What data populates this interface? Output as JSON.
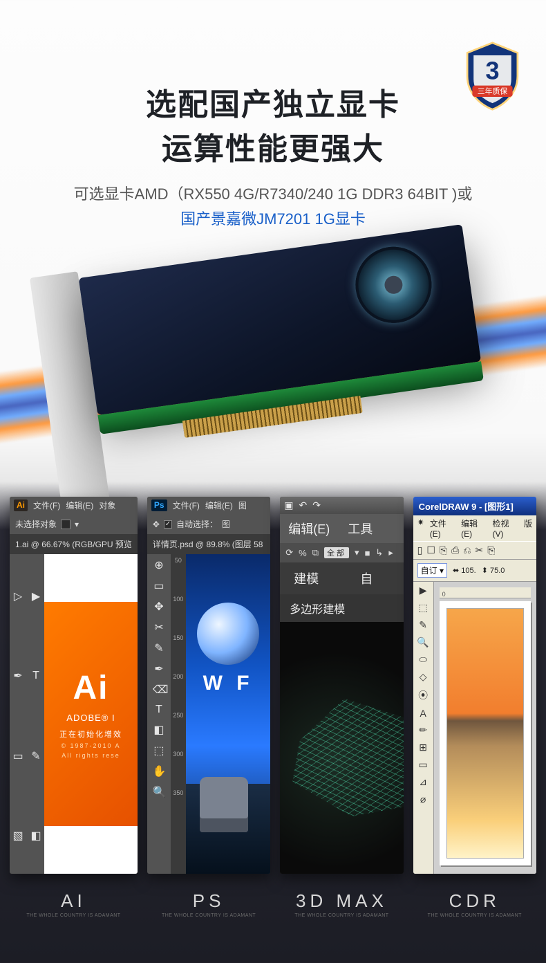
{
  "badge": {
    "year_label": "三年质保",
    "number": "3"
  },
  "hero": {
    "title_line1": "选配国产独立显卡",
    "title_line2": "运算性能更强大",
    "subtitle1": "可选显卡AMD（RX550 4G/R7340/240 1G DDR3 64BIT )或",
    "subtitle2": "国产景嘉微JM7201 1G显卡"
  },
  "apps": {
    "ai": {
      "logo": "Ai",
      "menu": [
        "文件(F)",
        "编辑(E)",
        "对象"
      ],
      "option_row_label": "未选择对象",
      "tab_label": "1.ai @ 66.67% (RGB/GPU 预览",
      "splash_logo": "Ai",
      "splash_name": "ADOBE® I",
      "splash_init": "正在初始化增效",
      "splash_copy1": "© 1987-2010 A",
      "splash_copy2": "All rights rese",
      "label": "AI",
      "sub": "THE WHOLE COUNTRY IS ADAMANT",
      "tools": [
        "▷",
        "▶",
        "✒",
        "T",
        "▭",
        "✎",
        "▧",
        "◧"
      ]
    },
    "ps": {
      "logo": "Ps",
      "menu": [
        "文件(F)",
        "编辑(E)",
        "图"
      ],
      "move_label": "自动选择：",
      "move_value": "图",
      "tab_label": "详情页.psd @ 89.8% (图层 58",
      "ruler": [
        "50",
        "100",
        "150",
        "200",
        "250",
        "300",
        "350"
      ],
      "brand": "W F",
      "label": "PS",
      "sub": "THE WHOLE COUNTRY IS ADAMANT",
      "tools": [
        "⊕",
        "▭",
        "✥",
        "✂",
        "✎",
        "✒",
        "⌫",
        "T",
        "◧",
        "⬚",
        "✋",
        "🔍"
      ]
    },
    "max": {
      "top_icons": [
        "▣",
        "↶",
        "↷"
      ],
      "menu": [
        "编辑(E)",
        "工具"
      ],
      "toolbar_icons": [
        "⟳",
        "%",
        "⧉"
      ],
      "toolbar_badge": "全部",
      "toolbar_extra": [
        "▾",
        "■",
        "↳",
        "▸"
      ],
      "tabs": [
        "建模",
        "自"
      ],
      "subtab": "多边形建模",
      "label": "3D MAX",
      "sub": "THE WHOLE COUNTRY IS ADAMANT"
    },
    "cdr": {
      "title": "CorelDRAW 9 - [图形1]",
      "menu_icon": "✷",
      "menu": [
        "文件(E)",
        "编辑(E)",
        "检视(V)",
        "版"
      ],
      "icons": [
        "▯",
        "☐",
        "⎘",
        "⎙",
        "⎌",
        "✂",
        "⎘"
      ],
      "prop_label": "自订",
      "coord1": "105.",
      "coord2": "75.0",
      "ruler_marks": "0",
      "label": "CDR",
      "sub": "THE WHOLE COUNTRY IS ADAMANT",
      "tools": [
        "▶",
        "⬚",
        "✎",
        "🔍",
        "⬭",
        "◇",
        "⦿",
        "A",
        "✏",
        "⊞",
        "▭",
        "⊿",
        "⌀"
      ]
    }
  }
}
